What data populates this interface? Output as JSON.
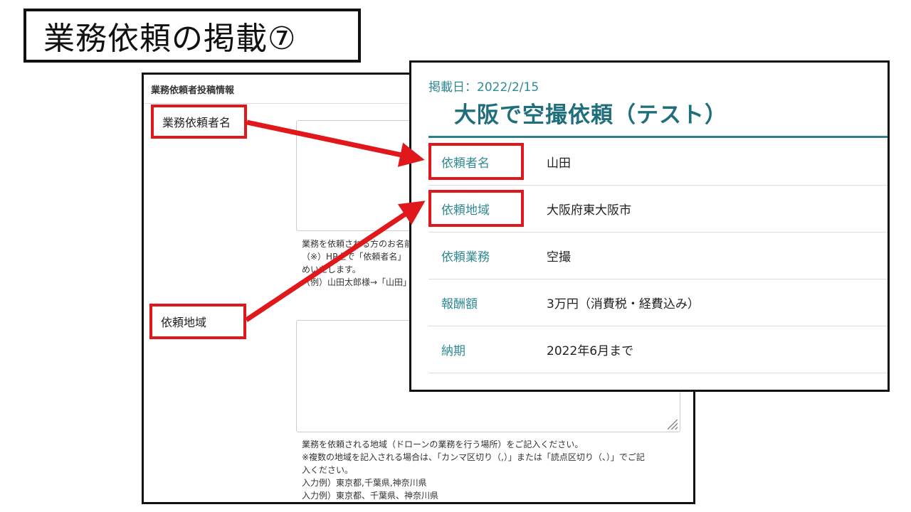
{
  "slide": {
    "title": "業務依頼の掲載⑦"
  },
  "form": {
    "section_header": "業務依頼者投稿情報",
    "requester_label": "業務依頼者名",
    "region_label": "依頼地域",
    "requester_help": [
      "業務を依頼される方のお名前",
      "（※）HP上で「依頼者名」",
      "めいたします。",
      "（例）山田太郎様→「山田」"
    ],
    "region_help": [
      "業務を依頼される地域（ドローンの業務を行う場所）をご記入ください。",
      "※複数の地域を記入される場合は、「カンマ区切り（,）」または「読点区切り（、）」でご記",
      "入ください。",
      "入力例）東京都,千葉県,神奈川県",
      "入力例）東京都、千葉県、神奈川県"
    ]
  },
  "post": {
    "date": "掲載日：2022/2/15",
    "title": "大阪で空撮依頼（テスト）",
    "rows": [
      {
        "key": "依頼者名",
        "value": "山田"
      },
      {
        "key": "依頼地域",
        "value": "大阪府東大阪市"
      },
      {
        "key": "依頼業務",
        "value": "空撮"
      },
      {
        "key": "報酬額",
        "value": "3万円（消費税・経費込み）"
      },
      {
        "key": "納期",
        "value": "2022年6月まで"
      }
    ]
  },
  "colors": {
    "highlight": "#e0181b",
    "teal": "#1e6f7b"
  }
}
